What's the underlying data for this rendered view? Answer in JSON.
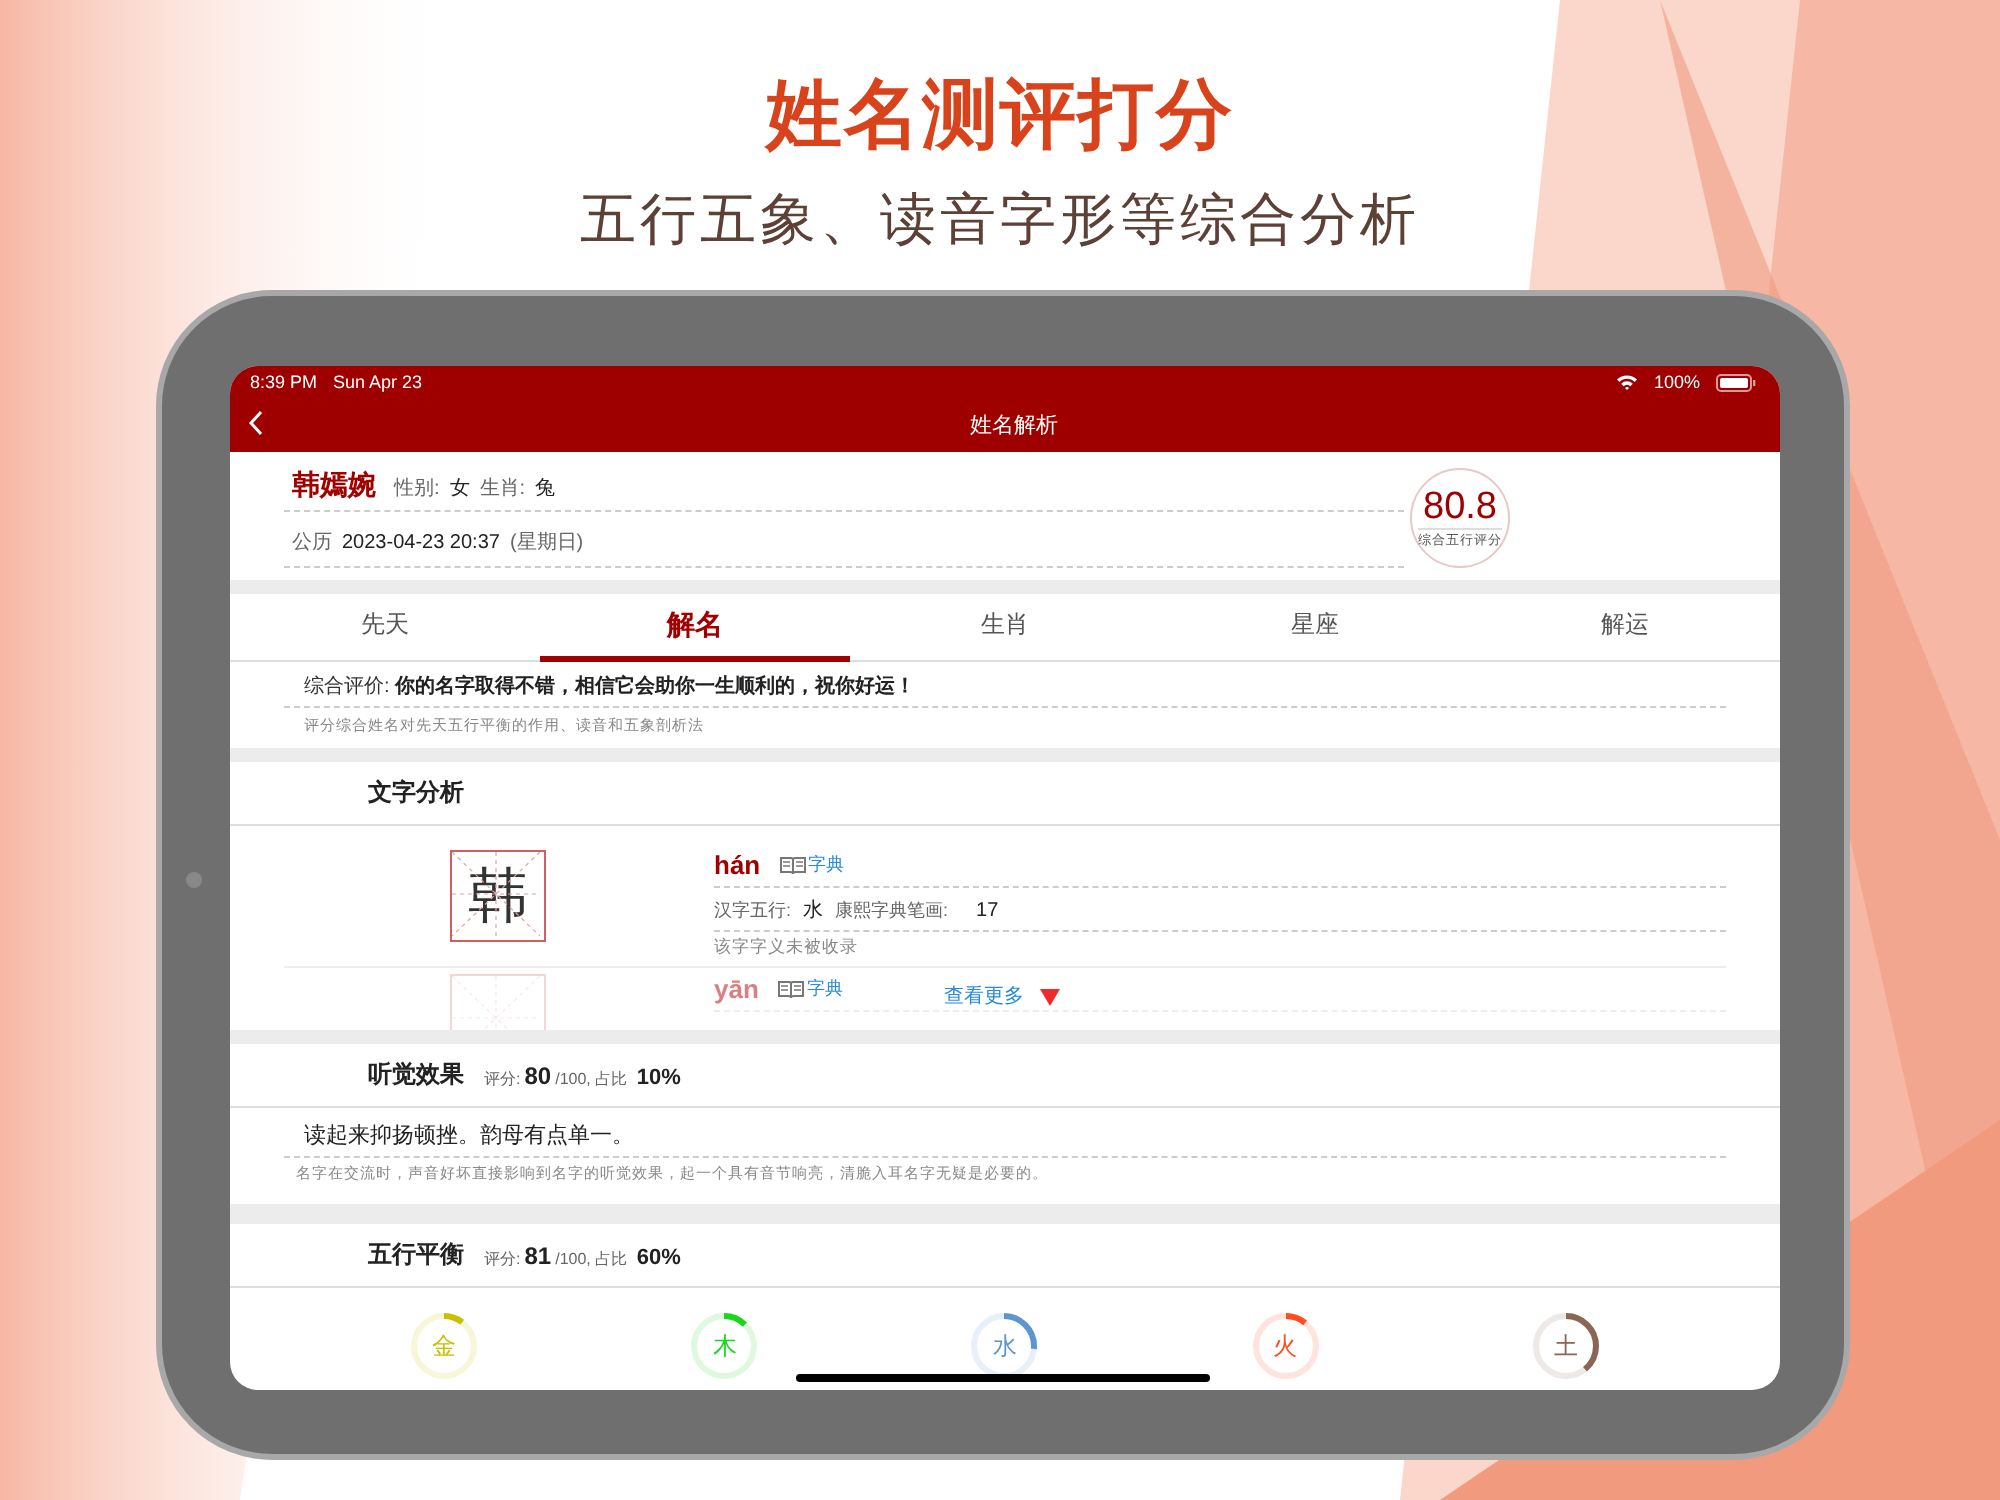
{
  "banner": {
    "title": "姓名测评打分",
    "subtitle": "五行五象、读音字形等综合分析"
  },
  "status_bar": {
    "time": "8:39 PM",
    "date": "Sun Apr 23",
    "battery": "100%"
  },
  "nav": {
    "title": "姓名解析"
  },
  "person": {
    "name": "韩嫣婉",
    "gender_label": "性别:",
    "gender": "女",
    "zodiac_label": "生肖:",
    "zodiac": "兔",
    "calendar_label": "公历",
    "datetime": "2023-04-23 20:37",
    "weekday": "(星期日)",
    "score": "80.8",
    "score_label": "综合五行评分"
  },
  "tabs": [
    {
      "label": "先天",
      "selected": false
    },
    {
      "label": "解名",
      "selected": true
    },
    {
      "label": "生肖",
      "selected": false
    },
    {
      "label": "星座",
      "selected": false
    },
    {
      "label": "解运",
      "selected": false
    }
  ],
  "evaluation": {
    "label": "综合评价:",
    "text": "你的名字取得不错，相信它会助你一生顺利的，祝你好运！",
    "note": "评分综合姓名对先天五行平衡的作用、读音和五象剖析法"
  },
  "char_analysis": {
    "title": "文字分析",
    "expanded": false,
    "more": "查看更多",
    "characters": [
      {
        "char": "韩",
        "pinyin": "hán",
        "dict": "字典",
        "wuxing_label": "汉字五行:",
        "wuxing": "水",
        "strokes_label": "康熙字典笔画:",
        "strokes": "17",
        "meaning": "该字字义未被收录"
      },
      {
        "pinyin": "yān",
        "dict": "字典"
      }
    ]
  },
  "hearing": {
    "title": "听觉效果",
    "score_label": "评分:",
    "score": "80",
    "score_max": "/100,",
    "share_label": "占比",
    "share": "10%",
    "text": "读起来抑扬顿挫。韵母有点单一。",
    "note": "名字在交流时，声音好坏直接影响到名字的听觉效果，起一个具有音节响亮，清脆入耳名字无疑是必要的。"
  },
  "wuxing": {
    "title": "五行平衡",
    "score_label": "评分:",
    "score": "81",
    "score_max": "/100,",
    "share_label": "占比",
    "share": "60%",
    "elements": [
      {
        "name": "金",
        "color": "#c6c000",
        "level": 0.104
      },
      {
        "name": "木",
        "color": "#1fd61f",
        "level": 0.123
      },
      {
        "name": "水",
        "color": "#5e95cf",
        "level": 0.265
      },
      {
        "name": "火",
        "color": "#ff4d1f",
        "level": 0.11
      },
      {
        "name": "土",
        "color": "#8a6656",
        "level": 0.39
      }
    ]
  }
}
